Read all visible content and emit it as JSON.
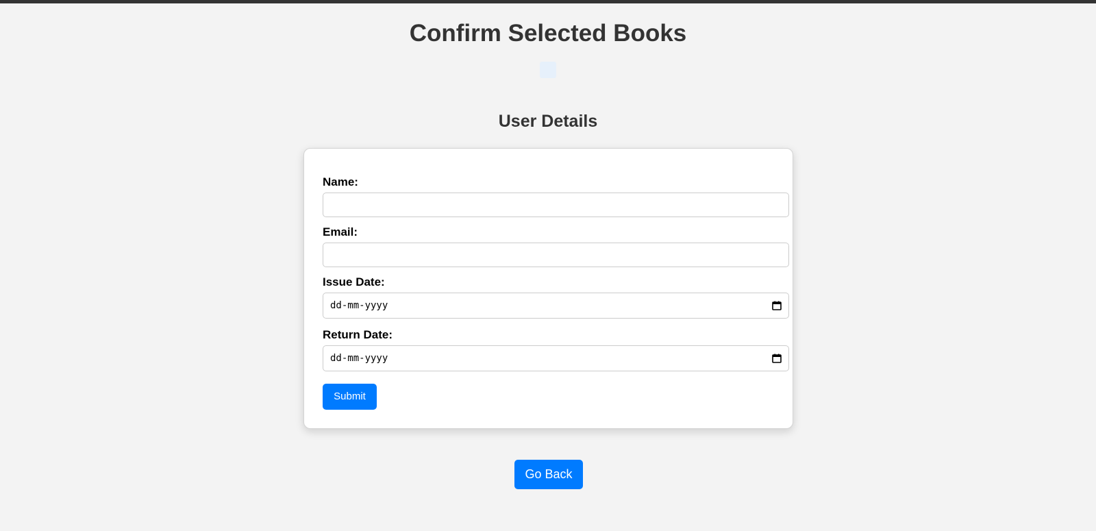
{
  "page": {
    "title": "Confirm Selected Books"
  },
  "user_details": {
    "heading": "User Details",
    "name_label": "Name:",
    "name_value": "",
    "email_label": "Email:",
    "email_value": "",
    "issue_date_label": "Issue Date:",
    "issue_date_placeholder": "dd-mm-yyyy",
    "return_date_label": "Return Date:",
    "return_date_placeholder": "dd-mm-yyyy",
    "submit_label": "Submit"
  },
  "navigation": {
    "back_label": "Go Back"
  },
  "colors": {
    "accent": "#007bff",
    "background": "#f3f3f3",
    "card": "#ffffff",
    "header_bar": "#333333"
  },
  "icons": {
    "date_picker": "calendar-icon"
  }
}
